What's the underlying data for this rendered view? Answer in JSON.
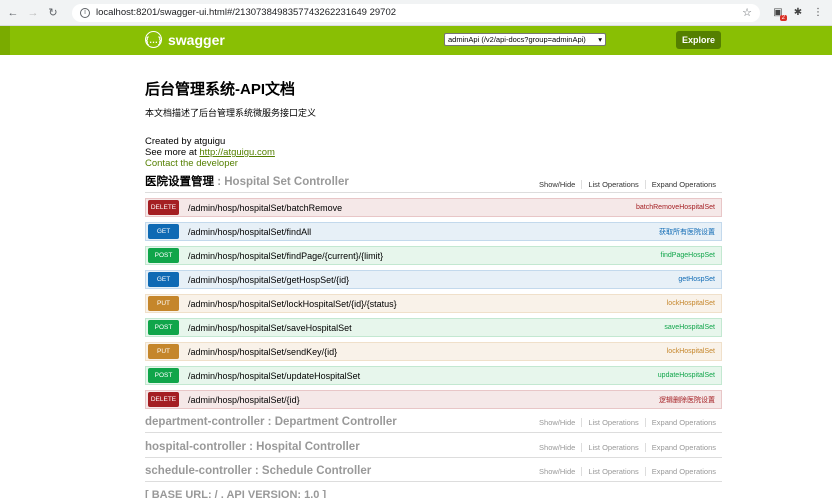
{
  "browser": {
    "url": "localhost:8201/swagger-ui.html#/2130738498357743262231649 29702",
    "ext_badge": "2"
  },
  "header": {
    "brand": "swagger",
    "api_select": "adminApi (/v2/api-docs?group=adminApi)",
    "explore_label": "Explore"
  },
  "info": {
    "title": "后台管理系统-API文档",
    "description": "本文档描述了后台管理系统微服务接口定义",
    "created_by": "Created by atguigu",
    "see_more_prefix": "See more at ",
    "see_more_link": "http://atguigu.com",
    "contact": "Contact the developer"
  },
  "resource_links": {
    "show_hide": "Show/Hide",
    "list_ops": "List Operations",
    "expand_ops": "Expand Operations"
  },
  "hospset": {
    "cn": "医院设置管理",
    "sep": " : ",
    "en": "Hospital Set Controller",
    "ops": [
      {
        "verb": "DELETE",
        "path": "/admin/hosp/hospitalSet/batchRemove",
        "summary": "batchRemoveHospitalSet"
      },
      {
        "verb": "GET",
        "path": "/admin/hosp/hospitalSet/findAll",
        "summary": "获取所有医院设置"
      },
      {
        "verb": "POST",
        "path": "/admin/hosp/hospitalSet/findPage/{current}/{limit}",
        "summary": "findPageHospSet"
      },
      {
        "verb": "GET",
        "path": "/admin/hosp/hospitalSet/getHospSet/{id}",
        "summary": "getHospSet"
      },
      {
        "verb": "PUT",
        "path": "/admin/hosp/hospitalSet/lockHospitalSet/{id}/{status}",
        "summary": "lockHospitalSet"
      },
      {
        "verb": "POST",
        "path": "/admin/hosp/hospitalSet/saveHospitalSet",
        "summary": "saveHospitalSet"
      },
      {
        "verb": "PUT",
        "path": "/admin/hosp/hospitalSet/sendKey/{id}",
        "summary": "lockHospitalSet"
      },
      {
        "verb": "POST",
        "path": "/admin/hosp/hospitalSet/updateHospitalSet",
        "summary": "updateHospitalSet"
      },
      {
        "verb": "DELETE",
        "path": "/admin/hosp/hospitalSet/{id}",
        "summary": "逻辑删除医院设置"
      }
    ]
  },
  "collapsed": [
    {
      "title": "department-controller : Department Controller"
    },
    {
      "title": "hospital-controller : Hospital Controller"
    },
    {
      "title": "schedule-controller : Schedule Controller"
    }
  ],
  "cut_text": "[ BASE URL: / , API VERSION: 1.0 ]"
}
